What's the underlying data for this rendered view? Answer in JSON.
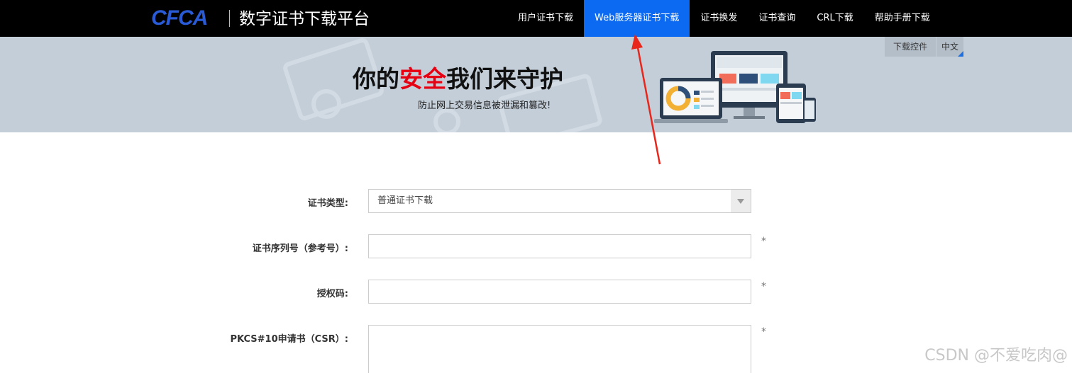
{
  "header": {
    "logo_text": "CFCA",
    "title": "数字证书下载平台",
    "nav": [
      {
        "label": "用户证书下载",
        "active": false
      },
      {
        "label": "Web服务器证书下载",
        "active": true
      },
      {
        "label": "证书换发",
        "active": false
      },
      {
        "label": "证书查询",
        "active": false
      },
      {
        "label": "CRL下载",
        "active": false
      },
      {
        "label": "帮助手册下载",
        "active": false
      }
    ],
    "accent_color": "#0c69f2"
  },
  "banner": {
    "slogan_pre": "你的",
    "slogan_highlight": "安全",
    "slogan_post": "我们来守护",
    "subslogan": "防止网上交易信息被泄漏和篡改!",
    "tools": {
      "download_control": "下载控件",
      "language": "中文"
    }
  },
  "form": {
    "cert_type_label": "证书类型:",
    "cert_type_value": "普通证书下载",
    "serial_label": "证书序列号（参考号）:",
    "serial_value": "",
    "auth_code_label": "授权码:",
    "auth_code_value": "",
    "csr_label": "PKCS#10申请书（CSR）:",
    "csr_value": "",
    "required_mark": "*"
  },
  "watermark": "CSDN @不爱吃肉@"
}
